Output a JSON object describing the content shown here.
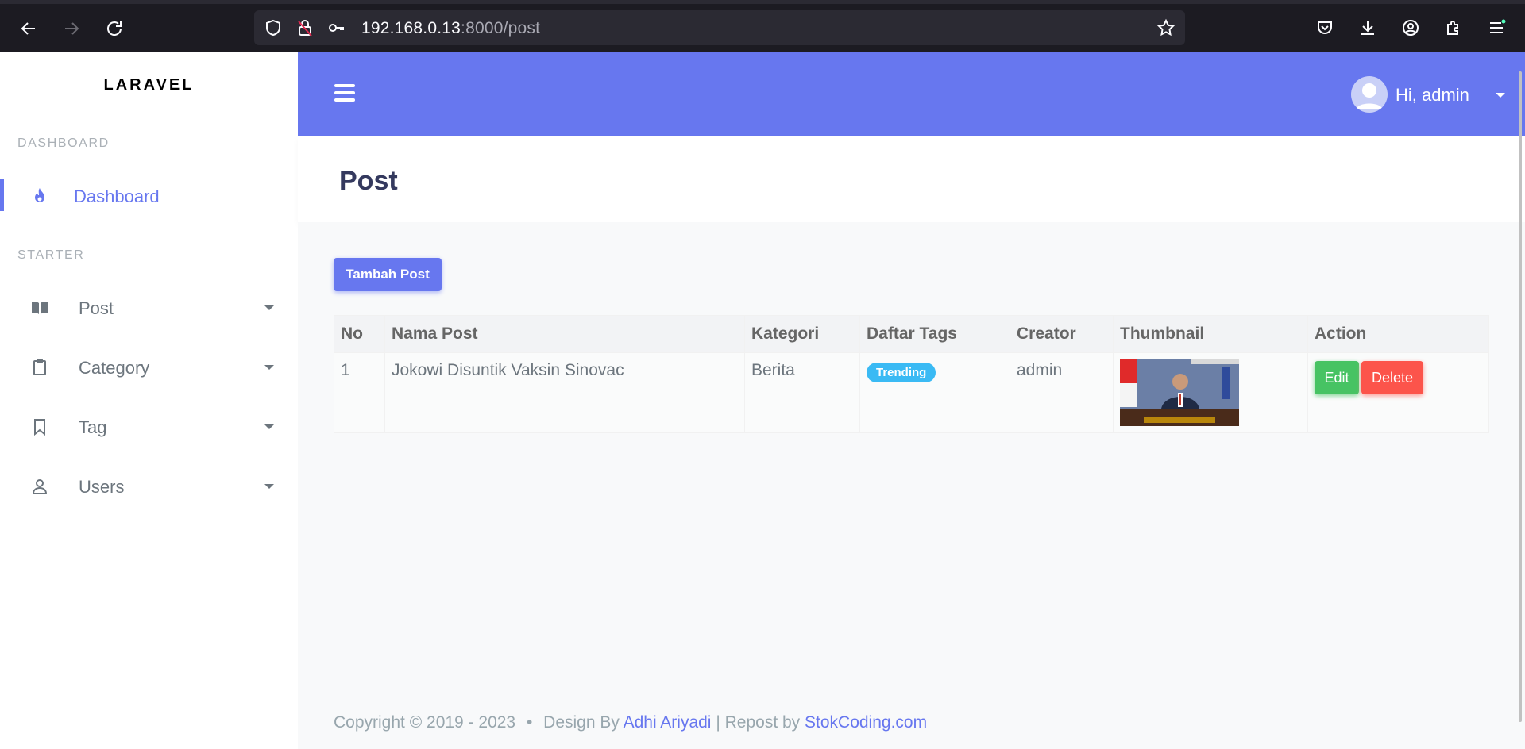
{
  "browser": {
    "url_host": "192.168.0.13",
    "url_rest": ":8000/post"
  },
  "sidebar": {
    "brand": "LARAVEL",
    "headers": [
      "DASHBOARD",
      "STARTER"
    ],
    "items": [
      {
        "label": "Dashboard",
        "icon": "fire-icon",
        "active": true
      },
      {
        "label": "Post",
        "icon": "book-icon"
      },
      {
        "label": "Category",
        "icon": "clipboard-icon"
      },
      {
        "label": "Tag",
        "icon": "bookmark-icon"
      },
      {
        "label": "Users",
        "icon": "user-icon"
      }
    ]
  },
  "navbar": {
    "user_greeting": "Hi, admin"
  },
  "page": {
    "title": "Post",
    "add_button": "Tambah Post"
  },
  "table": {
    "columns": [
      "No",
      "Nama Post",
      "Kategori",
      "Daftar Tags",
      "Creator",
      "Thumbnail",
      "Action"
    ],
    "rows": [
      {
        "no": "1",
        "name": "Jokowi Disuntik Vaksin Sinovac",
        "category": "Berita",
        "tag": "Trending",
        "creator": "admin",
        "edit_label": "Edit",
        "delete_label": "Delete"
      }
    ]
  },
  "footer": {
    "copyright": "Copyright © 2019 - 2023",
    "separator": "•",
    "design_by": "Design By",
    "author": "Adhi Ariyadi",
    "repost": "| Repost by",
    "site": "StokCoding.com"
  },
  "colors": {
    "primary": "#6777ef",
    "success": "#47c363",
    "danger": "#fc544b",
    "info": "#3abaf4"
  }
}
